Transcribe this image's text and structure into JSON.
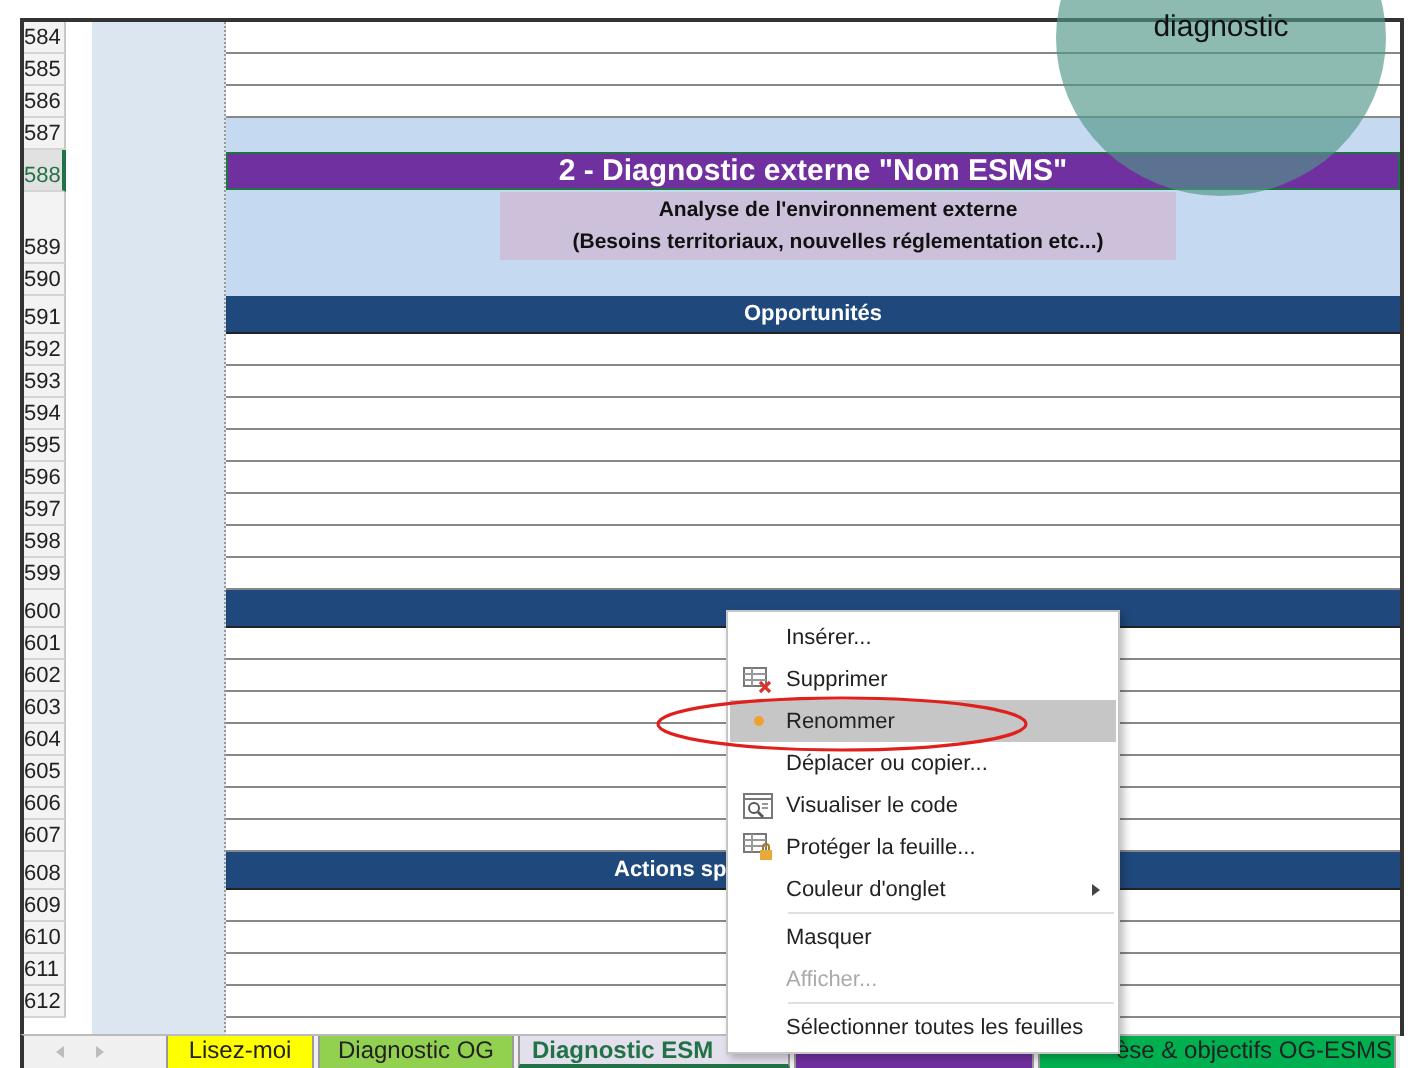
{
  "rows": [
    {
      "number": "584",
      "kind": "blank",
      "selected": false
    },
    {
      "number": "585",
      "kind": "blank",
      "selected": false
    },
    {
      "number": "586",
      "kind": "blank",
      "selected": false
    },
    {
      "number": "587",
      "kind": "band",
      "selected": false
    },
    {
      "number": "588",
      "kind": "title",
      "selected": true,
      "text": "2 - Diagnostic externe \"Nom ESMS\""
    },
    {
      "number": "589",
      "kind": "subtitle",
      "selected": false,
      "lines": [
        "Analyse de l'environnement externe",
        "(Besoins territoriaux, nouvelles réglementation etc...)"
      ]
    },
    {
      "number": "590",
      "kind": "band",
      "selected": false
    },
    {
      "number": "591",
      "kind": "header",
      "selected": false,
      "text": "Opportunités"
    },
    {
      "number": "592",
      "kind": "blank",
      "selected": false
    },
    {
      "number": "593",
      "kind": "blank",
      "selected": false
    },
    {
      "number": "594",
      "kind": "blank",
      "selected": false
    },
    {
      "number": "595",
      "kind": "blank",
      "selected": false
    },
    {
      "number": "596",
      "kind": "blank",
      "selected": false
    },
    {
      "number": "597",
      "kind": "blank",
      "selected": false
    },
    {
      "number": "598",
      "kind": "blank",
      "selected": false
    },
    {
      "number": "599",
      "kind": "blank",
      "selected": false
    },
    {
      "number": "600",
      "kind": "header",
      "selected": false
    },
    {
      "number": "601",
      "kind": "blank",
      "selected": false
    },
    {
      "number": "602",
      "kind": "blank",
      "selected": false
    },
    {
      "number": "603",
      "kind": "blank",
      "selected": false
    },
    {
      "number": "604",
      "kind": "blank",
      "selected": false
    },
    {
      "number": "605",
      "kind": "blank",
      "selected": false
    },
    {
      "number": "606",
      "kind": "blank",
      "selected": false
    },
    {
      "number": "607",
      "kind": "blank",
      "selected": false
    },
    {
      "number": "608",
      "kind": "header",
      "selected": false,
      "text": "Actions sp",
      "cut": true
    },
    {
      "number": "609",
      "kind": "blank",
      "selected": false
    },
    {
      "number": "610",
      "kind": "blank",
      "selected": false
    },
    {
      "number": "611",
      "kind": "blank",
      "selected": false
    },
    {
      "number": "612",
      "kind": "blank",
      "selected": false
    }
  ],
  "sheet_tabs": [
    {
      "label": "Lisez-moi",
      "color": "#ffff00",
      "selected": false
    },
    {
      "label": "Diagnostic OG",
      "color": "#92d050",
      "selected": false
    },
    {
      "label": "Diagnostic ESM",
      "color": "#e4dfec",
      "selected": true
    },
    {
      "color": "#7030a0",
      "selected": false
    },
    {
      "label": "èse & objectifs OG-ESMS",
      "color": "#00b050",
      "selected": false
    }
  ],
  "context_menu": [
    {
      "label": "Insérer...",
      "kind": "plain",
      "selected": false,
      "disabled": false
    },
    {
      "label": "Supprimer",
      "kind": "delete",
      "selected": false,
      "disabled": false
    },
    {
      "label": "Renommer",
      "kind": "dot",
      "selected": true,
      "disabled": false
    },
    {
      "label": "Déplacer ou copier...",
      "kind": "plain",
      "selected": false,
      "disabled": false
    },
    {
      "label": "Visualiser le code",
      "kind": "code",
      "selected": false,
      "disabled": false
    },
    {
      "label": "Protéger la feuille...",
      "kind": "protect",
      "selected": false,
      "disabled": false
    },
    {
      "label": "Couleur d'onglet",
      "kind": "plain",
      "submenu": true,
      "selected": false,
      "disabled": false
    },
    {
      "label": "Masquer",
      "kind": "plain",
      "separator_before": true,
      "selected": false,
      "disabled": false
    },
    {
      "label": "Afficher...",
      "kind": "plain",
      "selected": false,
      "disabled": true
    },
    {
      "label": "Sélectionner toutes les feuilles",
      "kind": "plain",
      "separator_before": true,
      "selected": false,
      "disabled": false
    }
  ],
  "overlay_badge": {
    "text": "diagnostic"
  }
}
